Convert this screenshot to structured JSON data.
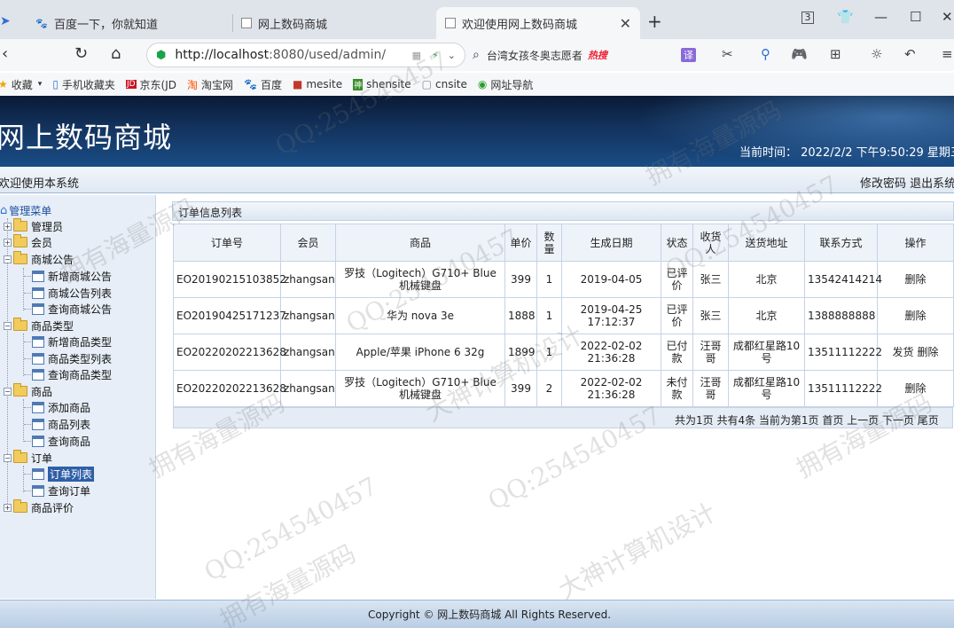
{
  "browser": {
    "tabs": [
      {
        "title": "百度一下，你就知道",
        "icon": "baidu-paw-icon"
      },
      {
        "title": "网上数码商城",
        "icon": "page-icon"
      },
      {
        "title": "欢迎使用网上数码商城",
        "icon": "page-icon",
        "active": true
      }
    ],
    "tab_count": "3",
    "url_host": "http://localhost",
    "url_rest": ":8080/used/admin/",
    "search_text": "台湾女孩冬奥志愿者",
    "search_hot": "热搜",
    "translate_label": "译",
    "bookmarks": [
      {
        "label": "收藏",
        "icon": "star-icon"
      },
      {
        "label": "手机收藏夹",
        "icon": "phone-icon"
      },
      {
        "label": "京东(JD",
        "icon": "jd-icon"
      },
      {
        "label": "淘宝网",
        "icon": "taobao-icon"
      },
      {
        "label": "百度",
        "icon": "baidu-paw-icon"
      },
      {
        "label": "mesite",
        "icon": "bookmark-icon"
      },
      {
        "label": "shensite",
        "icon": "bookmark-icon"
      },
      {
        "label": "cnsite",
        "icon": "page-icon"
      },
      {
        "label": "网址导航",
        "icon": "nav-icon"
      }
    ]
  },
  "app": {
    "title": "网上数码商城",
    "time_label": "当前时间： 2022/2/2 下午9:50:29 星期三",
    "welcome": "欢迎使用本系统",
    "change_password": "修改密码",
    "logout": "退出系统"
  },
  "sidebar": {
    "root": "管理菜单",
    "nodes": {
      "admin": "管理员",
      "member": "会员",
      "notice": "商城公告",
      "notice_add": "新增商城公告",
      "notice_list": "商城公告列表",
      "notice_query": "查询商城公告",
      "type": "商品类型",
      "type_add": "新增商品类型",
      "type_list": "商品类型列表",
      "type_query": "查询商品类型",
      "goods": "商品",
      "goods_add": "添加商品",
      "goods_list": "商品列表",
      "goods_query": "查询商品",
      "order": "订单",
      "order_list": "订单列表",
      "order_query": "查询订单",
      "review": "商品评价"
    }
  },
  "orders": {
    "panel_title": "订单信息列表",
    "headers": [
      "订单号",
      "会员",
      "商品",
      "单价",
      "数量",
      "生成日期",
      "状态",
      "收货人",
      "送货地址",
      "联系方式",
      "操作"
    ],
    "rows": [
      {
        "no": "EO20190215103852",
        "member": "zhangsan",
        "goods": "罗技（Logitech）G710+ Blue 机械键盘",
        "price": "399",
        "qty": "1",
        "date": "2019-04-05",
        "status": "已评价",
        "receiver": "张三",
        "address": "北京",
        "phone": "13542414214",
        "ship": "",
        "delete": "删除"
      },
      {
        "no": "EO20190425171237",
        "member": "zhangsan",
        "goods": "华为 nova 3e",
        "price": "1888",
        "qty": "1",
        "date": "2019-04-25 17:12:37",
        "status": "已评价",
        "receiver": "张三",
        "address": "北京",
        "phone": "1388888888",
        "ship": "",
        "delete": "删除"
      },
      {
        "no": "EO20220202213628",
        "member": "zhangsan",
        "goods": "Apple/苹果 iPhone 6 32g",
        "price": "1899",
        "qty": "1",
        "date": "2022-02-02 21:36:28",
        "status": "已付款",
        "receiver": "汪哥哥",
        "address": "成都红星路10号",
        "phone": "13511112222",
        "ship": "发货",
        "delete": "删除"
      },
      {
        "no": "EO20220202213628",
        "member": "zhangsan",
        "goods": "罗技（Logitech）G710+ Blue 机械键盘",
        "price": "399",
        "qty": "2",
        "date": "2022-02-02 21:36:28",
        "status": "未付款",
        "receiver": "汪哥哥",
        "address": "成都红星路10号",
        "phone": "13511112222",
        "ship": "",
        "delete": "删除"
      }
    ],
    "pager": "共为1页  共有4条  当前为第1页  首页  上一页  下一页  尾页"
  },
  "footer": "Copyright © 网上数码商城 All Rights Reserved.",
  "watermarks": [
    "QQ:254540457",
    "拥有海量源码",
    "大神计算机设计"
  ]
}
